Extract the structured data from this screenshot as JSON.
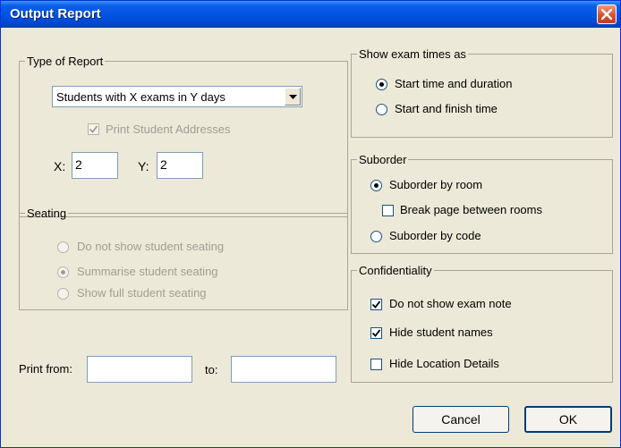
{
  "window": {
    "title": "Output Report"
  },
  "type_of_report": {
    "legend": "Type of Report",
    "selected_report": "Students with X exams in Y days",
    "print_addresses": {
      "label": "Print Student Addresses",
      "checked": true,
      "enabled": false
    },
    "x_label": "X:",
    "x_value": "2",
    "y_label": "Y:",
    "y_value": "2"
  },
  "seating": {
    "legend": "Seating",
    "options": [
      {
        "label": "Do not show student seating",
        "selected": false
      },
      {
        "label": "Summarise student seating",
        "selected": true
      },
      {
        "label": "Show full student seating",
        "selected": false
      }
    ]
  },
  "print_range": {
    "from_label": "Print from:",
    "from_value": "",
    "to_label": "to:",
    "to_value": ""
  },
  "exam_times": {
    "legend": "Show exam times as",
    "options": [
      {
        "label": "Start time and duration",
        "selected": true
      },
      {
        "label": "Start and finish time",
        "selected": false
      }
    ]
  },
  "suborder": {
    "legend": "Suborder",
    "by_room": {
      "label": "Suborder by room",
      "selected": true
    },
    "break_page": {
      "label": "Break page between rooms",
      "checked": false
    },
    "by_code": {
      "label": "Suborder by code",
      "selected": false
    }
  },
  "confidentiality": {
    "legend": "Confidentiality",
    "options": [
      {
        "label": "Do not show exam note",
        "checked": true
      },
      {
        "label": "Hide student names",
        "checked": true
      },
      {
        "label": "Hide Location Details",
        "checked": false
      }
    ]
  },
  "buttons": {
    "cancel": "Cancel",
    "ok": "OK"
  },
  "colors": {
    "titlebar": "#0054e3",
    "dialog_bg": "#ece9d8",
    "close_button": "#d8512e"
  }
}
